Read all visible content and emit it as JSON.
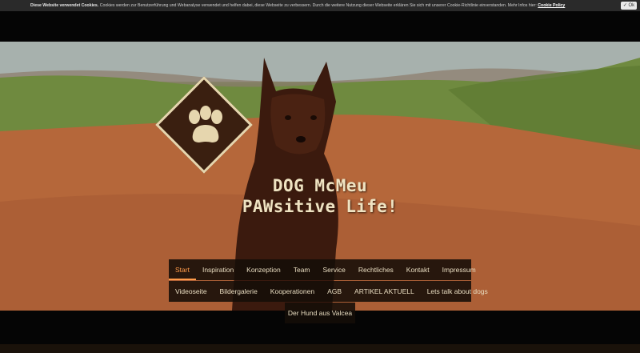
{
  "cookie": {
    "heading": "Diese Website verwendet Cookies.",
    "text": "Cookies werden zur Benutzerführung und Webanalyse verwendet und helfen dabei, diese Webseite zu verbessern. Durch die weitere Nutzung dieser Webseite erklären Sie sich mit unserer Cookie-Richtlinie einverstanden. Mehr Infos hier:",
    "link": "Cookie Policy",
    "ok_label": "Ok",
    "ok_icon": "check-icon"
  },
  "site": {
    "title": "DOG McMeu",
    "subtitle": "PAWsitive Life!",
    "logo_icon": "paw-icon"
  },
  "nav": {
    "row1": [
      "Start",
      "Inspiration",
      "Konzeption",
      "Team",
      "Service",
      "Rechtliches",
      "Kontakt",
      "Impressum"
    ],
    "row2": [
      "Videoseite",
      "Bildergalerie",
      "Kooperationen",
      "AGB",
      "ARTIKEL AKTUELL",
      "Lets talk about dogs"
    ],
    "row3": [
      "Der Hund aus Valcea"
    ],
    "active": "Start"
  },
  "colors": {
    "accent": "#ff9b4a",
    "nav_bg": "#140e08",
    "logo_bg": "#3a1f10",
    "logo_border": "#e6d6ae"
  }
}
